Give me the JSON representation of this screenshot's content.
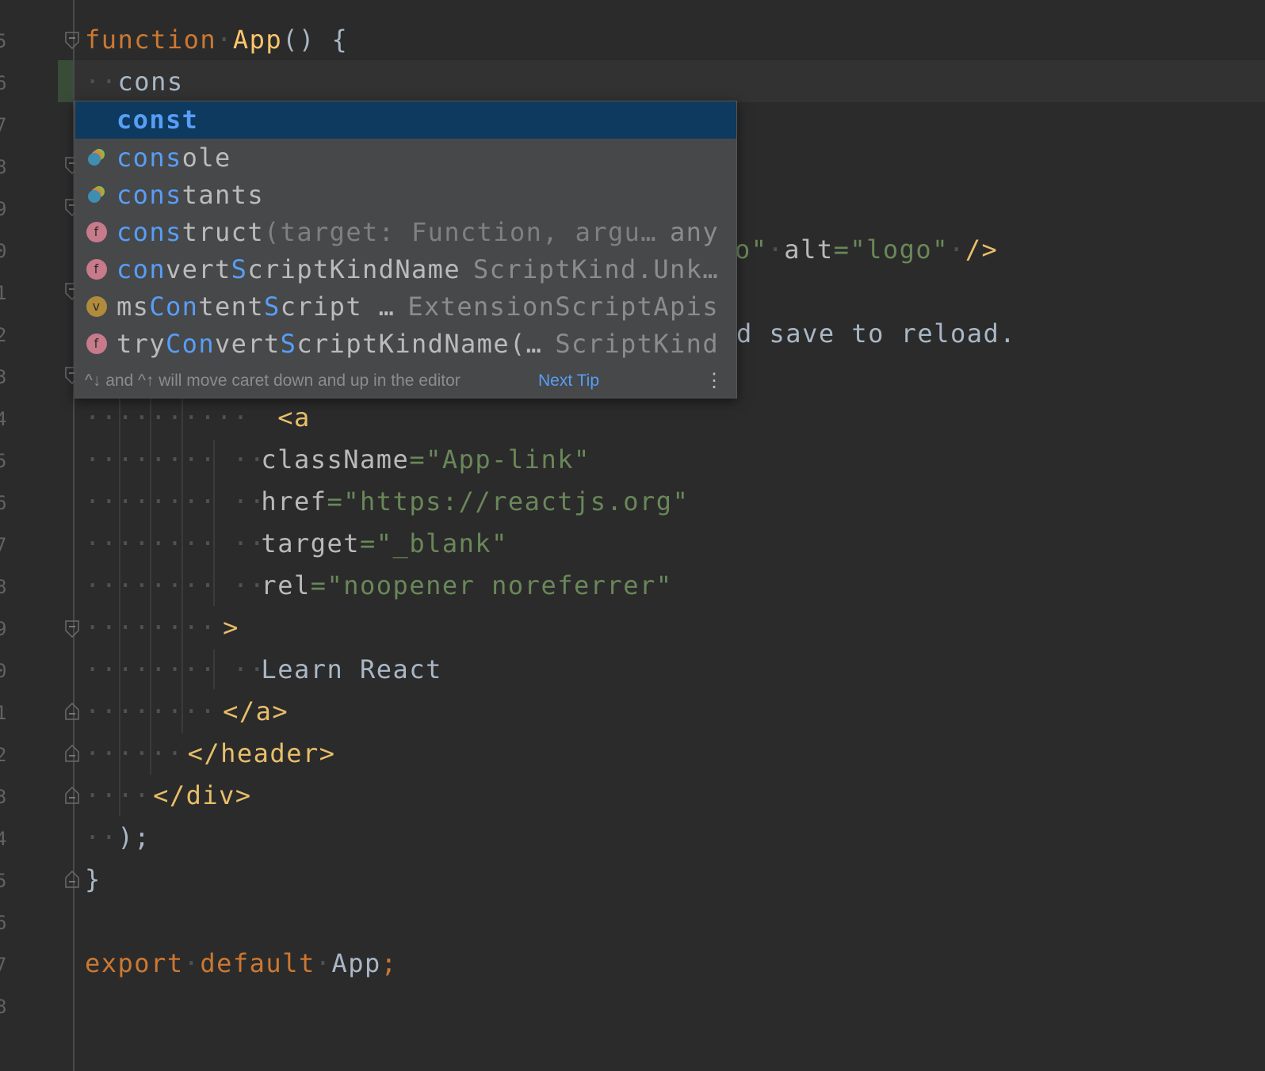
{
  "line_numbers": [
    "5",
    "6",
    "7",
    "8",
    "9",
    "0",
    "1",
    "2",
    "3",
    "4",
    "5",
    "6",
    "7",
    "8",
    "9",
    "0",
    "1",
    "2",
    "3",
    "4",
    "5",
    "6",
    "7",
    "8"
  ],
  "code": {
    "l1": {
      "kw": "function",
      "name": "App",
      "rest": "() {"
    },
    "l2": {
      "typed": "cons"
    },
    "l_img_tail": {
      "s1": "o\"",
      "attr": "alt",
      "s2": "\"logo\"",
      "end": "/>"
    },
    "l_p_tail": {
      "text": "d save to reload."
    },
    "l_a_open": "<a",
    "l_classname": {
      "attr": "className",
      "val": "\"App-link\""
    },
    "l_href": {
      "attr": "href",
      "val": "\"https://reactjs.org\""
    },
    "l_target": {
      "attr": "target",
      "val": "\"_blank\""
    },
    "l_rel": {
      "attr": "rel",
      "val": "\"noopener noreferrer\""
    },
    "l_gt": ">",
    "l_learn": "Learn React",
    "l_a_close": "</a>",
    "l_header_close": "</header>",
    "l_div_close": "</div>",
    "l_paren": ");",
    "l_brace": "}",
    "l_export": {
      "kw1": "export",
      "kw2": "default",
      "name": "App",
      "semi": ";"
    }
  },
  "completion": {
    "items": [
      {
        "label": "const",
        "type": "",
        "icon": "none"
      },
      {
        "match": "cons",
        "rest": "ole",
        "type": "",
        "icon": "property-icon"
      },
      {
        "match": "cons",
        "rest": "tants",
        "type": "",
        "icon": "property-icon"
      },
      {
        "match": "cons",
        "rest": "truct",
        "params": "(target: Function, argu…",
        "type": "any",
        "icon": "function-icon"
      },
      {
        "pre": "",
        "m1": "con",
        "mid": "vert",
        "m2": "S",
        "post": "criptKindName",
        "type": "ScriptKind.Unk…",
        "icon": "function-icon"
      },
      {
        "pre": "ms",
        "m1": "Con",
        "mid": "tent",
        "m2": "S",
        "post": "cript …",
        "type": "ExtensionScriptApis",
        "icon": "variable-icon"
      },
      {
        "pre": "try",
        "m1": "Con",
        "mid": "vert",
        "m2": "S",
        "post": "criptKindName(…",
        "type": "ScriptKind",
        "icon": "function-icon"
      }
    ],
    "icon_letters": {
      "function": "f",
      "variable": "v"
    },
    "footer_hint": "^↓ and ^↑ will move caret down and up in the editor",
    "footer_link": "Next Tip"
  },
  "colors": {
    "background": "#2b2b2b",
    "keyword": "#cc7832",
    "function": "#ffc66d",
    "string": "#6a8759",
    "selection": "#0d3a5e",
    "match": "#589df6"
  }
}
